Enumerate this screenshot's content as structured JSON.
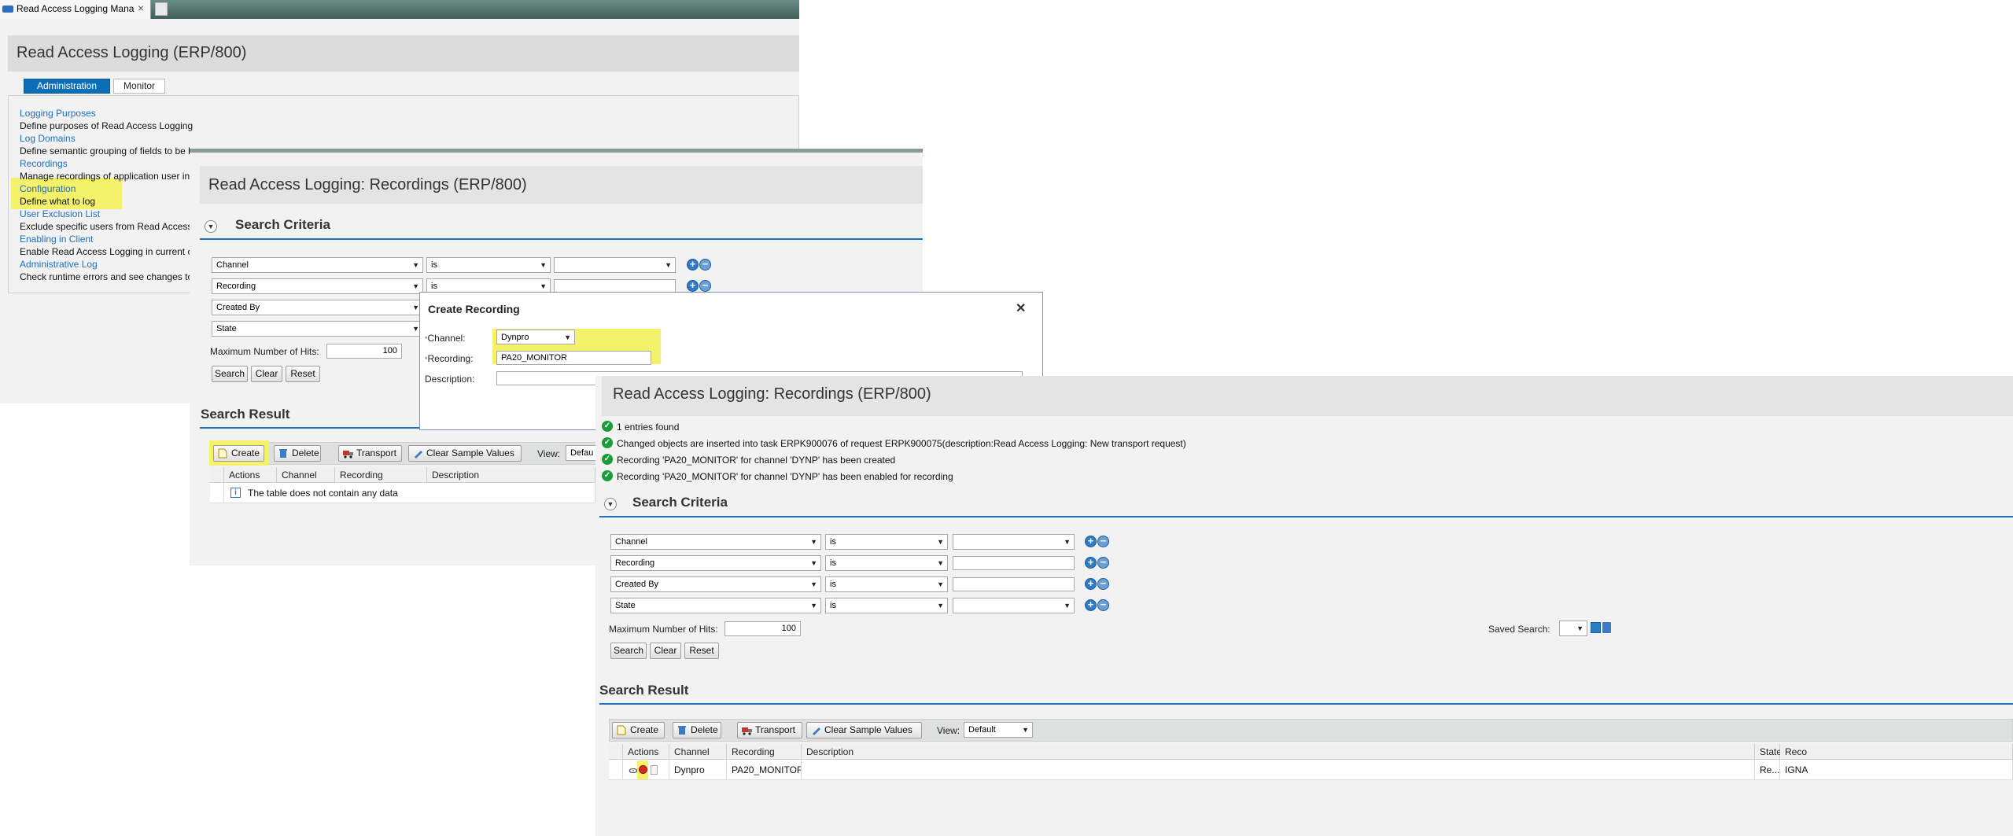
{
  "browser": {
    "tab_title": "Read Access Logging Mana",
    "close_glyph": "×"
  },
  "admin": {
    "title": "Read Access Logging (ERP/800)",
    "tabs": [
      "Administration",
      "Monitor"
    ],
    "links": [
      {
        "label": "Logging Purposes",
        "desc": "Define purposes of Read Access Logging"
      },
      {
        "label": "Log Domains",
        "desc": "Define semantic grouping of fields to be l"
      },
      {
        "label": "Recordings",
        "desc": "Manage recordings of application user in"
      },
      {
        "label": "Configuration",
        "desc": "Define what to log"
      },
      {
        "label": "User Exclusion List",
        "desc": "Exclude specific users from Read Access"
      },
      {
        "label": "Enabling in Client",
        "desc": "Enable Read Access Logging in current c"
      },
      {
        "label": "Administrative Log",
        "desc": "Check runtime errors and see changes to"
      }
    ]
  },
  "recordings_bg": {
    "title": "Read Access Logging: Recordings (ERP/800)",
    "search_criteria": "Search Criteria",
    "criteria": [
      {
        "field": "Channel",
        "op": "is"
      },
      {
        "field": "Recording",
        "op": "is"
      },
      {
        "field": "Created By",
        "op": ""
      },
      {
        "field": "State",
        "op": ""
      }
    ],
    "max_hits_label": "Maximum Number of Hits:",
    "max_hits_value": "100",
    "buttons": [
      "Search",
      "Clear",
      "Reset"
    ],
    "search_result": "Search Result",
    "toolbar": {
      "create": "Create",
      "delete": "Delete",
      "transport": "Transport",
      "clear_sample": "Clear Sample Values",
      "view_label": "View:",
      "view_value": "Defau"
    },
    "columns": [
      "Actions",
      "Channel",
      "Recording",
      "Description"
    ],
    "empty_text": "The table does not contain any data"
  },
  "dialog": {
    "title": "Create Recording",
    "close_glyph": "✕",
    "channel_label": "Channel:",
    "channel_value": "Dynpro",
    "recording_label": "Recording:",
    "recording_value": "PA20_MONITOR",
    "description_label": "Description:",
    "required_glyph": "*"
  },
  "recordings_fg": {
    "title": "Read Access Logging: Recordings (ERP/800)",
    "messages": [
      "1 entries found",
      "Changed objects are inserted into task ERPK900076 of request ERPK900075(description:Read Access Logging: New transport request)",
      "Recording 'PA20_MONITOR' for channel 'DYNP' has been created",
      "Recording 'PA20_MONITOR' for channel 'DYNP' has been enabled for recording"
    ],
    "search_criteria": "Search Criteria",
    "criteria": [
      {
        "field": "Channel",
        "op": "is",
        "value": ""
      },
      {
        "field": "Recording",
        "op": "is",
        "value": ""
      },
      {
        "field": "Created By",
        "op": "is",
        "value": ""
      },
      {
        "field": "State",
        "op": "is",
        "value": ""
      }
    ],
    "max_hits_label": "Maximum Number of Hits:",
    "max_hits_value": "100",
    "saved_search_label": "Saved Search:",
    "buttons": [
      "Search",
      "Clear",
      "Reset"
    ],
    "search_result": "Search Result",
    "toolbar": {
      "create": "Create",
      "delete": "Delete",
      "transport": "Transport",
      "clear_sample": "Clear Sample Values",
      "view_label": "View:",
      "view_value": "Default"
    },
    "columns": [
      "Actions",
      "Channel",
      "Recording",
      "Description",
      "State",
      "Reco"
    ],
    "row": {
      "channel": "Dynpro",
      "recording": "PA20_MONITOR",
      "description": "",
      "state": "Re...",
      "reco": "IGNA"
    }
  },
  "colors": {
    "accent": "#0a6fb6",
    "highlight": "#f3f26a",
    "success": "#1a9c3a"
  }
}
